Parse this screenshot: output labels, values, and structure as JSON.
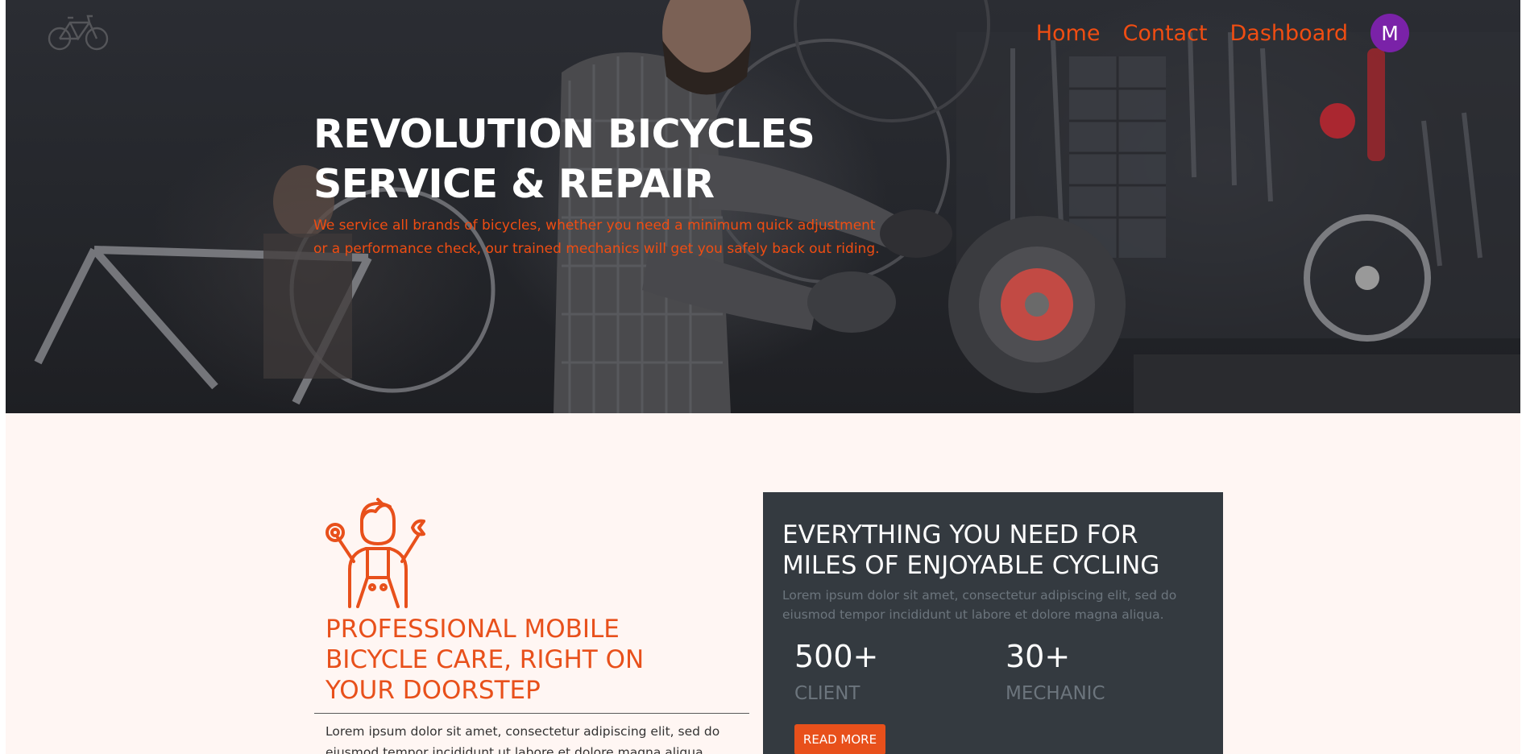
{
  "nav": {
    "items": [
      {
        "label": "Home"
      },
      {
        "label": "Contact"
      },
      {
        "label": "Dashboard"
      }
    ],
    "avatar_initial": "M",
    "brand_icon": "bicycle-icon"
  },
  "hero": {
    "title_line1": "REVOLUTION BICYCLES",
    "title_line2": "SERVICE & REPAIR",
    "subtitle": "We service all brands of bicycles, whether you need a minimum quick adjustment or a performance check, our trained mechanics will get you safely back out riding."
  },
  "intro": {
    "icon": "mechanic-icon",
    "title": "PROFESSIONAL MOBILE BICYCLE CARE, RIGHT ON YOUR DOORSTEP",
    "text": "Lorem ipsum dolor sit amet, consectetur adipiscing elit, sed do eiusmod tempor incididunt ut labore et dolore magna aliqua."
  },
  "card": {
    "title": "EVERYTHING YOU NEED FOR MILES OF ENJOYABLE CYCLING",
    "text": "Lorem ipsum dolor sit amet, consectetur adipiscing elit, sed do eiusmod tempor incididunt ut labore et dolore magna aliqua.",
    "stats": [
      {
        "number": "500+",
        "label": "CLIENT"
      },
      {
        "number": "30+",
        "label": "MECHANIC"
      }
    ],
    "button": "READ MORE"
  },
  "colors": {
    "accent": "#f04d12",
    "avatar": "#7a22a8",
    "card_bg": "#343a40",
    "section_bg": "#fff6f3"
  }
}
